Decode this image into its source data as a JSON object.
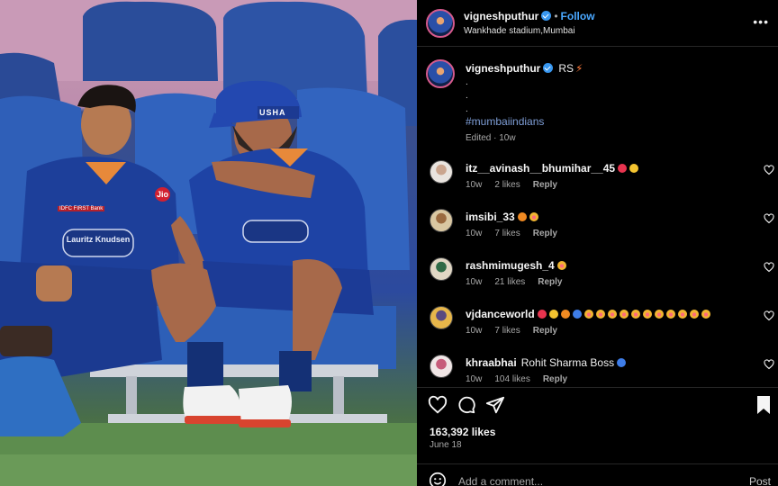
{
  "post": {
    "author": "vigneshputhur",
    "follow_label": "Follow",
    "location": "Wankhade stadium,Mumbai",
    "caption_text": "RS",
    "caption_dots": [
      ".",
      ".",
      "."
    ],
    "hashtag": "#mumbaiindians",
    "edited": "Edited · 10w",
    "likes": "163,392 likes",
    "date": "June 18",
    "add_comment_placeholder": "Add a comment...",
    "post_label": "Post"
  },
  "photo": {
    "jersey_sponsor": "Lauritz Knudsen",
    "jersey_bank": "IDFC FIRST Bank",
    "cap_text": "USHA",
    "jio": "Jio"
  },
  "comments": [
    {
      "user": "itz__avinash__bhumihar__45",
      "text": "",
      "emoji": [
        "red",
        "yel"
      ],
      "age": "10w",
      "likes": "2 likes",
      "reply": "Reply"
    },
    {
      "user": "imsibi_33",
      "text": "",
      "emoji": [
        "org",
        "star"
      ],
      "age": "10w",
      "likes": "7 likes",
      "reply": "Reply"
    },
    {
      "user": "rashmimugesh_4",
      "text": "",
      "emoji": [
        "star"
      ],
      "age": "10w",
      "likes": "21 likes",
      "reply": "Reply"
    },
    {
      "user": "vjdanceworld",
      "text": "",
      "emoji": [
        "red",
        "yel",
        "org",
        "blu",
        "star",
        "star",
        "star",
        "star",
        "star",
        "star",
        "star",
        "star",
        "star",
        "star",
        "star"
      ],
      "age": "10w",
      "likes": "7 likes",
      "reply": "Reply"
    },
    {
      "user": "khraabhai",
      "text": "Rohit Sharma Boss",
      "emoji": [
        "blu"
      ],
      "age": "10w",
      "likes": "104 likes",
      "reply": "Reply"
    }
  ],
  "icons": {
    "more": "more-options-icon",
    "like": "heart-icon",
    "comment": "comment-icon",
    "share": "share-icon",
    "save": "bookmark-icon",
    "emoji": "emoji-icon"
  },
  "colors": {
    "follow": "#4aa8ff",
    "hashtag": "#7f9fd8",
    "verified": "#3897f0",
    "background": "#000000"
  }
}
